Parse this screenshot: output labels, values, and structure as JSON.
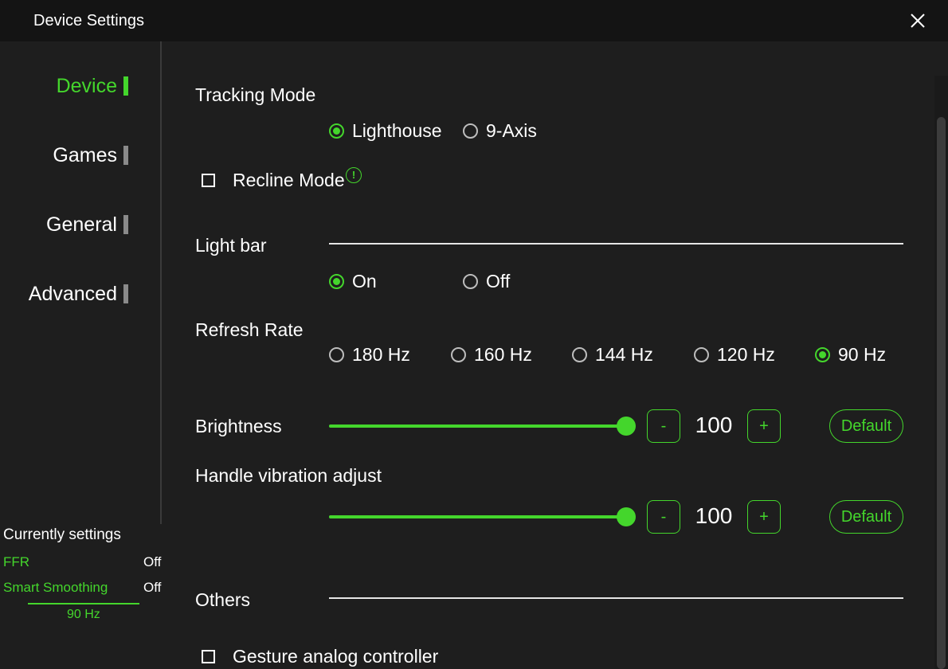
{
  "window": {
    "title": "Device Settings"
  },
  "sidebar": {
    "items": [
      {
        "label": "Device",
        "active": true
      },
      {
        "label": "Games",
        "active": false
      },
      {
        "label": "General",
        "active": false
      },
      {
        "label": "Advanced",
        "active": false
      }
    ],
    "current": {
      "title": "Currently settings",
      "rows": [
        {
          "key": "FFR",
          "value": "Off"
        },
        {
          "key": "Smart Smoothing",
          "value": "Off"
        }
      ],
      "refresh": "90 Hz"
    }
  },
  "main": {
    "tracking_mode": {
      "label": "Tracking Mode",
      "options": [
        "Lighthouse",
        "9-Axis"
      ],
      "selected": "Lighthouse"
    },
    "recline_mode": {
      "label": "Recline Mode",
      "checked": false,
      "info_icon": "!"
    },
    "light_bar": {
      "label": "Light bar",
      "options": [
        "On",
        "Off"
      ],
      "selected": "On"
    },
    "refresh_rate": {
      "label": "Refresh Rate",
      "options": [
        "180 Hz",
        "160 Hz",
        "144 Hz",
        "120 Hz",
        "90 Hz"
      ],
      "selected": "90 Hz"
    },
    "brightness": {
      "label": "Brightness",
      "value": "100",
      "level": 1.0,
      "minus": "-",
      "plus": "+",
      "default": "Default"
    },
    "vibration": {
      "label": "Handle vibration adjust",
      "value": "100",
      "level": 1.0,
      "minus": "-",
      "plus": "+",
      "default": "Default"
    },
    "others": {
      "label": "Others"
    },
    "gesture": {
      "label": "Gesture analog controller",
      "checked": false
    }
  },
  "colors": {
    "accent": "#44d62c",
    "background": "#1e1e1e",
    "titlebar": "#141414"
  }
}
